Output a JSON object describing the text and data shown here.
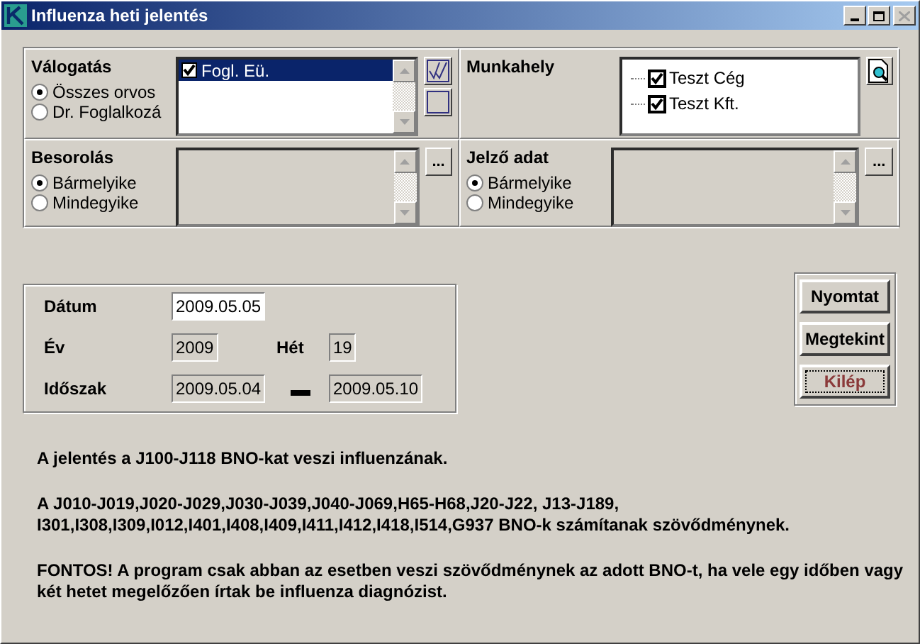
{
  "window": {
    "title": "Influenza heti jelentés"
  },
  "valogatas": {
    "label": "Válogatás",
    "options": [
      {
        "label": "Összes orvos",
        "selected": true
      },
      {
        "label": "Dr. Foglalkozá",
        "selected": false
      }
    ],
    "items": [
      {
        "label": "Fogl. Eü.",
        "checked": true,
        "selected": true
      }
    ]
  },
  "munkahely": {
    "label": "Munkahely",
    "items": [
      {
        "label": "Teszt Cég",
        "checked": true
      },
      {
        "label": "Teszt Kft.",
        "checked": true
      }
    ]
  },
  "besorolas": {
    "label": "Besorolás",
    "options": [
      {
        "label": "Bármelyike",
        "selected": true
      },
      {
        "label": "Mindegyike",
        "selected": false
      }
    ],
    "more": "..."
  },
  "jelzo": {
    "label": "Jelző adat",
    "options": [
      {
        "label": "Bármelyike",
        "selected": true
      },
      {
        "label": "Mindegyike",
        "selected": false
      }
    ],
    "more": "..."
  },
  "date": {
    "datum_label": "Dátum",
    "datum": "2009.05.05",
    "ev_label": "Év",
    "ev": "2009",
    "het_label": "Hét",
    "het": "19",
    "idoszak_label": "Időszak",
    "from": "2009.05.04",
    "to": "2009.05.10"
  },
  "buttons": [
    {
      "label": "Nyomtat",
      "kind": "normal"
    },
    {
      "label": "Megtekint",
      "kind": "normal"
    },
    {
      "label": "Kilép",
      "kind": "focused"
    }
  ],
  "notes": [
    "A jelentés a J100-J118 BNO-kat veszi influenzának.",
    "A J010-J019,J020-J029,J030-J039,J040-J069,H65-H68,J20-J22, J13-J189,\nI301,I308,I309,I012,I401,I408,I409,I411,I412,I418,I514,G937 BNO-k számítanak szövődménynek.",
    "FONTOS! A program csak abban az esetben veszi szövődménynek az adott BNO-t, ha vele egy időben vagy\nkét hetet megelőzően írtak be influenza diagnózist."
  ]
}
